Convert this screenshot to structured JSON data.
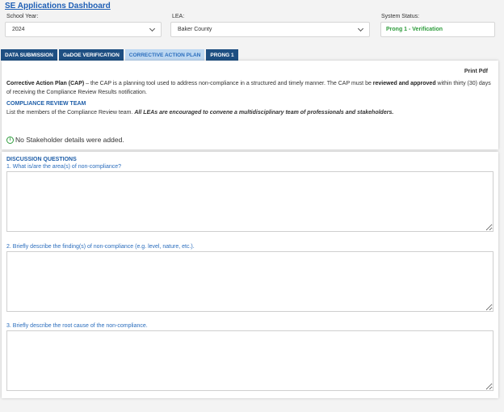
{
  "header": {
    "title": "SE Applications Dashboard"
  },
  "filters": {
    "school_year": {
      "label": "School Year:",
      "value": "2024"
    },
    "lea": {
      "label": "LEA:",
      "value": "Baker County"
    },
    "system_status": {
      "label": "System Status:",
      "value": "Prong 1 - Verification"
    }
  },
  "tabs": [
    {
      "label": "DATA SUBMISSION"
    },
    {
      "label": "GaDOE VERIFICATION"
    },
    {
      "label": "CORRECTIVE ACTION PLAN"
    },
    {
      "label": "PRONG 1"
    }
  ],
  "panel": {
    "print_label": "Print Pdf",
    "cap": {
      "term": "Corrective Action Plan (CAP)",
      "text1": " – the CAP is a planning tool used to address non-compliance in a structured and timely manner. The CAP must be ",
      "emph": "reviewed and approved",
      "text2": " within thirty (30) days of receiving the Compliance Review Results notification."
    },
    "team": {
      "heading": "COMPLIANCE REVIEW TEAM",
      "text": "List the members of the Compliance Review team. ",
      "emph": "All LEAs are encouraged to convene a multidisciplinary team of professionals and stakeholders.",
      "empty": "No Stakeholder details were added."
    }
  },
  "discussion": {
    "heading": "DISCUSSION QUESTIONS",
    "questions": [
      {
        "label": "1. What is/are the area(s) of non-compliance?",
        "value": ""
      },
      {
        "label": "2. Briefly describe the finding(s) of non-compliance (e.g. level, nature, etc.).",
        "value": ""
      },
      {
        "label": "3. Briefly describe the root cause of the non-compliance.",
        "value": ""
      }
    ]
  }
}
